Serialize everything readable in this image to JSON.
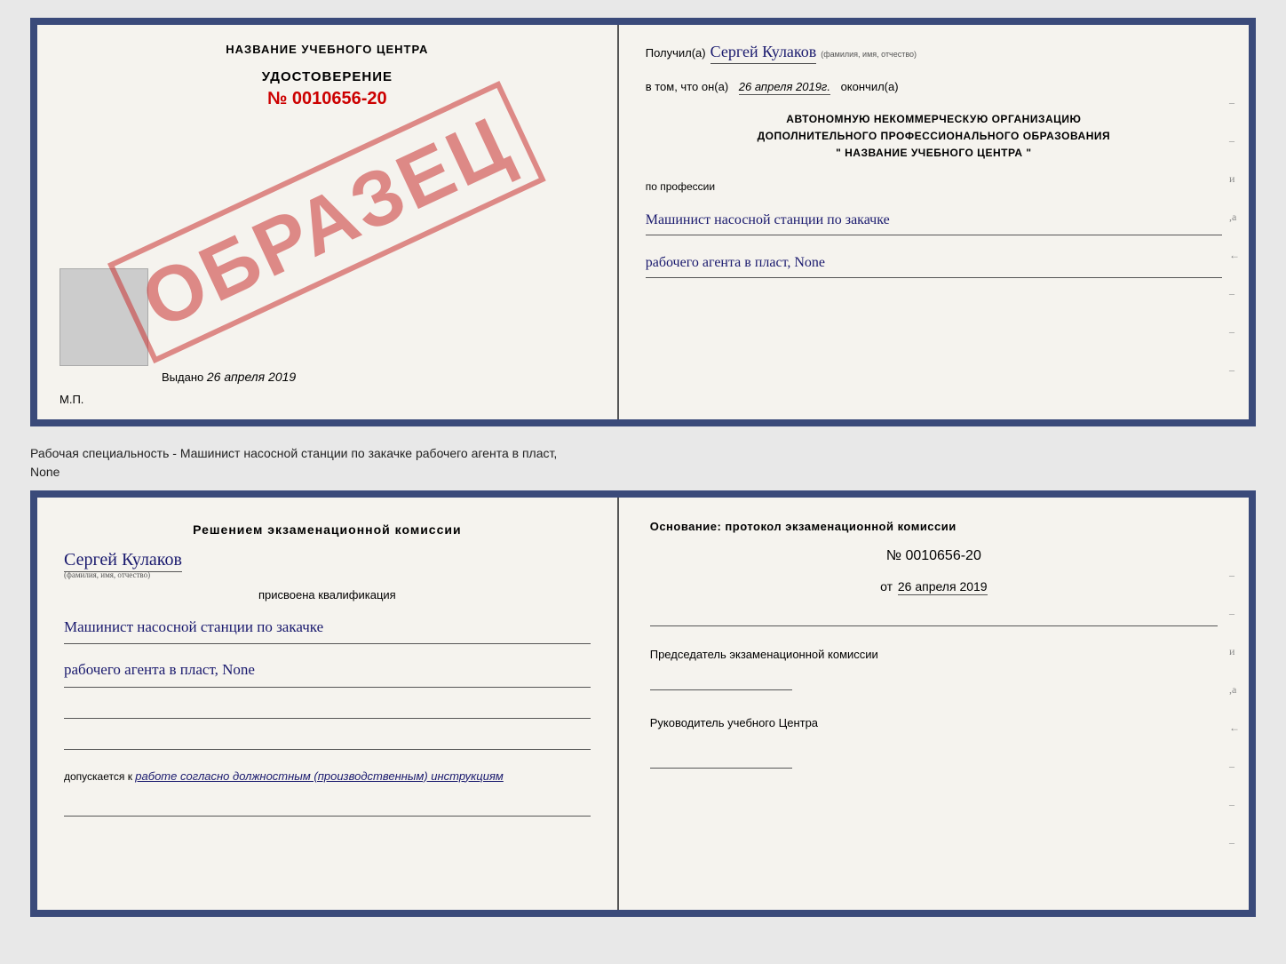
{
  "top_doc": {
    "left": {
      "title": "НАЗВАНИЕ УЧЕБНОГО ЦЕНТРА",
      "stamp_text": "ОБРАЗЕЦ",
      "cert_label": "УДОСТОВЕРЕНИЕ",
      "cert_number": "№ 0010656-20",
      "issued_prefix": "Выдано",
      "issued_date": "26 апреля 2019",
      "mp_label": "М.П."
    },
    "right": {
      "recipient_prefix": "Получил(а)",
      "recipient_name": "Сергей Кулаков",
      "recipient_hint": "(фамилия, имя, отчество)",
      "date_prefix": "в том, что он(а)",
      "date_value": "26 апреля 2019г.",
      "date_suffix": "окончил(а)",
      "org_line1": "АВТОНОМНУЮ НЕКОММЕРЧЕСКУЮ ОРГАНИЗАЦИЮ",
      "org_line2": "ДОПОЛНИТЕЛЬНОГО ПРОФЕССИОНАЛЬНОГО ОБРАЗОВАНИЯ",
      "org_line3": "\" НАЗВАНИЕ УЧЕБНОГО ЦЕНТРА \"",
      "profession_prefix": "по профессии",
      "profession_line1": "Машинист насосной станции по закачке",
      "profession_line2": "рабочего агента в пласт, None"
    }
  },
  "subtitle": {
    "line1": "Рабочая специальность - Машинист насосной станции по закачке рабочего агента в пласт,",
    "line2": "None"
  },
  "bottom_doc": {
    "left": {
      "commission_title": "Решением  экзаменационной  комиссии",
      "person_name": "Сергей Кулаков",
      "person_hint": "(фамилия, имя, отчество)",
      "assigned_label": "присвоена квалификация",
      "qual_line1": "Машинист насосной станции по закачке",
      "qual_line2": "рабочего агента в пласт, None",
      "admitted_prefix": "допускается к",
      "admitted_val": "работе согласно должностным (производственным) инструкциям"
    },
    "right": {
      "basis_title": "Основание: протокол экзаменационной комиссии",
      "protocol_number": "№ 0010656-20",
      "protocol_date_prefix": "от",
      "protocol_date": "26 апреля 2019",
      "chairman_label": "Председатель экзаменационной комиссии",
      "head_label": "Руководитель учебного Центра"
    }
  }
}
